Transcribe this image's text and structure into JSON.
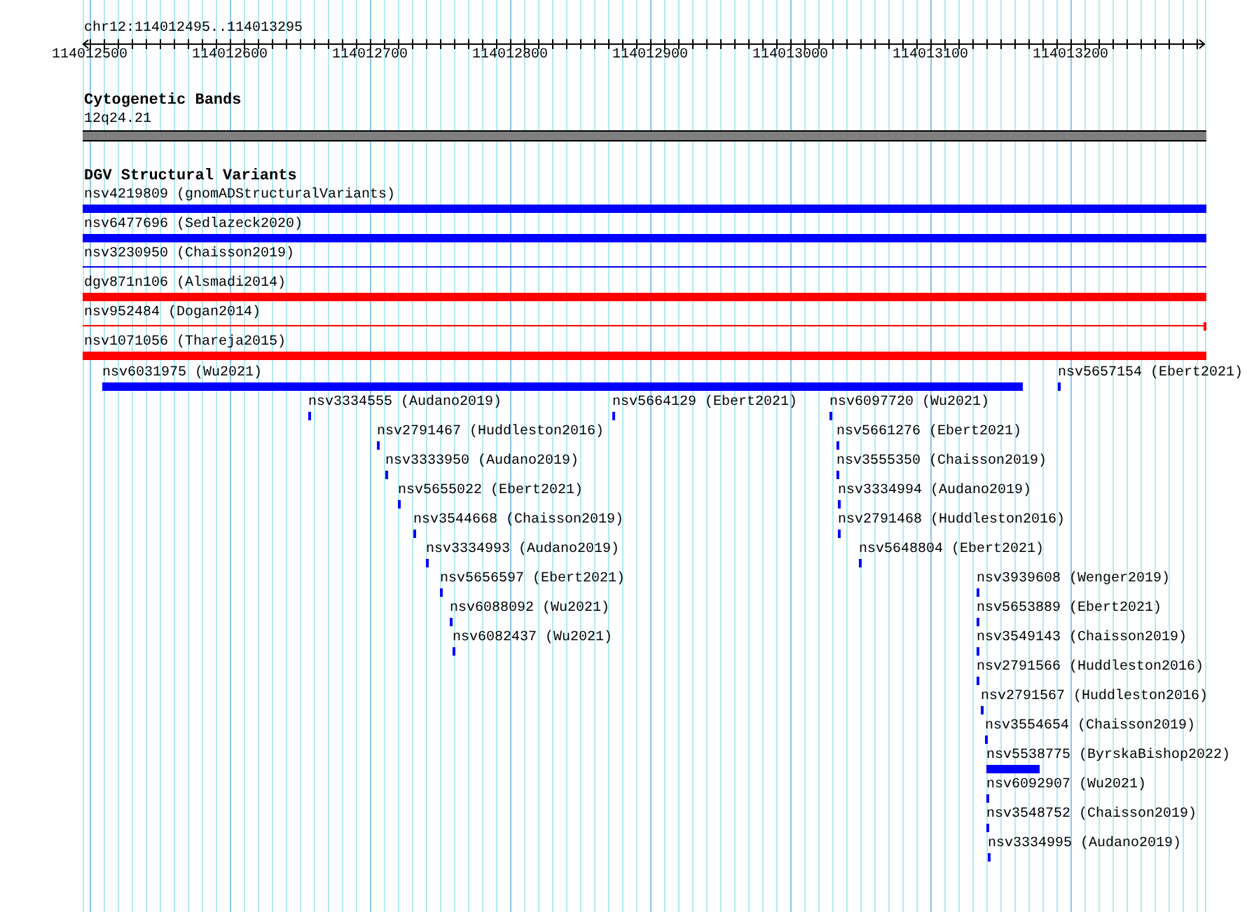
{
  "ruler": {
    "region": "chr12:114012495..114013295",
    "tick_labels": [
      "114012500",
      "114012600",
      "114012700",
      "114012800",
      "114012900",
      "114013000",
      "114013100",
      "114013200"
    ]
  },
  "cytogenetic_bands": {
    "title": "Cytogenetic Bands",
    "band": {
      "label": "12q24.21"
    }
  },
  "dgv_track": {
    "title": "DGV Structural Variants",
    "variants": [
      {
        "label": "nsv4219809 (gnomADStructuralVariants)",
        "kind": "bar",
        "color": "#0000ff"
      },
      {
        "label": "nsv6477696 (Sedlazeck2020)",
        "kind": "bar",
        "color": "#0000ff"
      },
      {
        "label": "nsv3230950 (Chaisson2019)",
        "kind": "line",
        "color": "#0000ff",
        "end_tick": false
      },
      {
        "label": "dgv871n106 (Alsmadi2014)",
        "kind": "bar",
        "color": "#ff0000"
      },
      {
        "label": "nsv952484 (Dogan2014)",
        "kind": "line",
        "color": "#ff0000",
        "end_tick": true
      },
      {
        "label": "nsv1071056 (Thareja2015)",
        "kind": "bar",
        "color": "#ff0000"
      },
      {
        "label": "nsv6031975 (Wu2021)",
        "kind": "bar",
        "color": "#0000ff"
      },
      {
        "label": "nsv5657154 (Ebert2021)",
        "kind": "bar",
        "color": "#0000ff"
      },
      {
        "label": "nsv3334555 (Audano2019)",
        "kind": "bar",
        "color": "#0000ff"
      },
      {
        "label": "nsv5664129 (Ebert2021)",
        "kind": "bar",
        "color": "#0000ff"
      },
      {
        "label": "nsv6097720 (Wu2021)",
        "kind": "bar",
        "color": "#0000ff"
      },
      {
        "label": "nsv2791467 (Huddleston2016)",
        "kind": "bar",
        "color": "#0000ff"
      },
      {
        "label": "nsv5661276 (Ebert2021)",
        "kind": "bar",
        "color": "#0000ff"
      },
      {
        "label": "nsv3333950 (Audano2019)",
        "kind": "bar",
        "color": "#0000ff"
      },
      {
        "label": "nsv3555350 (Chaisson2019)",
        "kind": "bar",
        "color": "#0000ff"
      },
      {
        "label": "nsv5655022 (Ebert2021)",
        "kind": "bar",
        "color": "#0000ff"
      },
      {
        "label": "nsv3334994 (Audano2019)",
        "kind": "bar",
        "color": "#0000ff"
      },
      {
        "label": "nsv3544668 (Chaisson2019)",
        "kind": "bar",
        "color": "#0000ff"
      },
      {
        "label": "nsv2791468 (Huddleston2016)",
        "kind": "bar",
        "color": "#0000ff"
      },
      {
        "label": "nsv3334993 (Audano2019)",
        "kind": "bar",
        "color": "#0000ff"
      },
      {
        "label": "nsv5648804 (Ebert2021)",
        "kind": "bar",
        "color": "#0000ff"
      },
      {
        "label": "nsv5656597 (Ebert2021)",
        "kind": "bar",
        "color": "#0000ff"
      },
      {
        "label": "nsv3939608 (Wenger2019)",
        "kind": "bar",
        "color": "#0000ff"
      },
      {
        "label": "nsv6088092 (Wu2021)",
        "kind": "bar",
        "color": "#0000ff"
      },
      {
        "label": "nsv5653889 (Ebert2021)",
        "kind": "bar",
        "color": "#0000ff"
      },
      {
        "label": "nsv6082437 (Wu2021)",
        "kind": "bar",
        "color": "#0000ff"
      },
      {
        "label": "nsv3549143 (Chaisson2019)",
        "kind": "bar",
        "color": "#0000ff"
      },
      {
        "label": "nsv2791566 (Huddleston2016)",
        "kind": "bar",
        "color": "#0000ff"
      },
      {
        "label": "nsv2791567 (Huddleston2016)",
        "kind": "bar",
        "color": "#0000ff"
      },
      {
        "label": "nsv3554654 (Chaisson2019)",
        "kind": "bar",
        "color": "#0000ff"
      },
      {
        "label": "nsv5538775 (ByrskaBishop2022)",
        "kind": "bar",
        "color": "#0000ff"
      },
      {
        "label": "nsv6092907 (Wu2021)",
        "kind": "bar",
        "color": "#0000ff"
      },
      {
        "label": "nsv3548752 (Chaisson2019)",
        "kind": "bar",
        "color": "#0000ff"
      },
      {
        "label": "nsv3334995 (Audano2019)",
        "kind": "bar",
        "color": "#0000ff"
      }
    ]
  }
}
